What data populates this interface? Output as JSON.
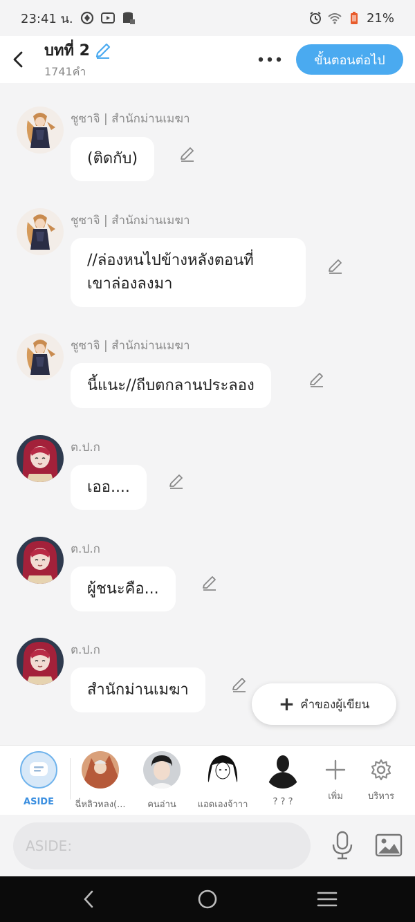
{
  "status_bar": {
    "time": "23:41 น.",
    "battery": "21%"
  },
  "header": {
    "title": "บทที่ 2",
    "word_count": "1741คำ",
    "next_button": "ขั้นตอนต่อไป"
  },
  "messages": [
    {
      "sender": "ชูซาจิ | สำนักม่านเมฆา",
      "lines": [
        "(ติดกับ)"
      ]
    },
    {
      "sender": "ชูซาจิ | สำนักม่านเมฆา",
      "lines": [
        "//ล่องหนไปข้างหลังตอนที่",
        "เขาล่องลงมา"
      ]
    },
    {
      "sender": "ชูซาจิ | สำนักม่านเมฆา",
      "lines": [
        "นี้แนะ//ถีบตกลานประลอง"
      ]
    },
    {
      "sender": "ต.ป.ก",
      "lines": [
        "เออ...."
      ]
    },
    {
      "sender": "ต.ป.ก",
      "lines": [
        "ผู้ชนะคือ..."
      ]
    },
    {
      "sender": "ต.ป.ก",
      "lines": [
        "สำนักม่านเมฆา"
      ]
    }
  ],
  "fab": {
    "label": "คำของผู้เขียน"
  },
  "characters": [
    {
      "label": "ASIDE"
    },
    {
      "label": "ฉี่หลิวหลง(..."
    },
    {
      "label": "คนอ่าน"
    },
    {
      "label": "แอดเองจ้าาา"
    },
    {
      "label": "? ? ?"
    },
    {
      "label": "เพิ่ม"
    },
    {
      "label": "บริหาร"
    }
  ],
  "input": {
    "placeholder": "ASIDE:"
  },
  "colors": {
    "accent": "#4aaaf0",
    "aside_blue": "#3b8fe0",
    "background": "#f4f4f5"
  },
  "icons": [
    "back-icon",
    "pencil-icon",
    "more-icon",
    "edit-icon",
    "plus-icon",
    "gear-icon",
    "mic-icon",
    "image-icon",
    "nav-back-icon",
    "nav-home-icon",
    "nav-recents-icon"
  ]
}
